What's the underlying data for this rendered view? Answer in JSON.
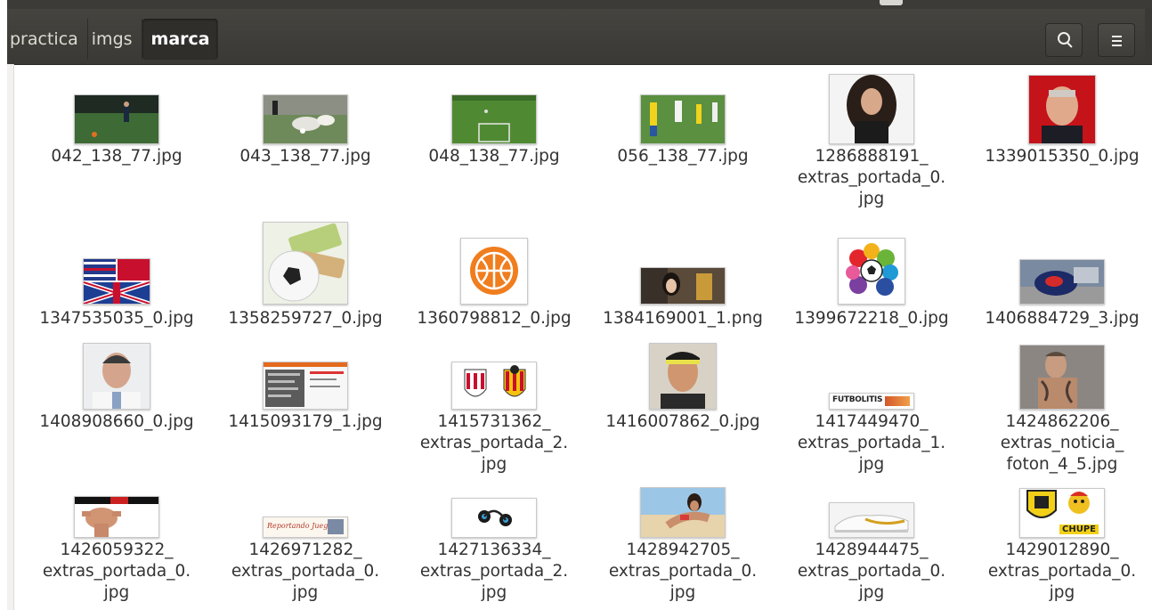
{
  "breadcrumbs": [
    "practica",
    "imgs",
    "marca"
  ],
  "header": {
    "search_icon": "search-icon",
    "menu_icon": "menu-icon"
  },
  "files": [
    {
      "name_lines": [
        "042_138_77.jpg"
      ],
      "icon": "soccer-photo-thumbnail"
    },
    {
      "name_lines": [
        "043_138_77.jpg"
      ],
      "icon": "soccer-photo-thumbnail"
    },
    {
      "name_lines": [
        "048_138_77.jpg"
      ],
      "icon": "soccer-field-thumbnail"
    },
    {
      "name_lines": [
        "056_138_77.jpg"
      ],
      "icon": "soccer-photo-thumbnail"
    },
    {
      "name_lines": [
        "1286888191_",
        "extras_portada_0.",
        "jpg"
      ],
      "icon": "portrait-thumbnail"
    },
    {
      "name_lines": [
        "1339015350_0.jpg"
      ],
      "icon": "portrait-thumbnail"
    },
    {
      "name_lines": [
        "1347535035_0.jpg"
      ],
      "icon": "flags-logo-thumbnail"
    },
    {
      "name_lines": [
        "1358259727_0.jpg"
      ],
      "icon": "money-ball-thumbnail"
    },
    {
      "name_lines": [
        "1360798812_0.jpg"
      ],
      "icon": "basketball-logo-thumbnail"
    },
    {
      "name_lines": [
        "1384169001_1.png"
      ],
      "icon": "photo-thumbnail"
    },
    {
      "name_lines": [
        "1399672218_0.jpg"
      ],
      "icon": "liga-logo-thumbnail"
    },
    {
      "name_lines": [
        "1406884729_3.jpg"
      ],
      "icon": "photo-thumbnail"
    },
    {
      "name_lines": [
        "1408908660_0.jpg"
      ],
      "icon": "portrait-thumbnail"
    },
    {
      "name_lines": [
        "1415093179_1.jpg"
      ],
      "icon": "webpage-thumbnail"
    },
    {
      "name_lines": [
        "1415731362_",
        "extras_portada_2.",
        "jpg"
      ],
      "icon": "club-crests-thumbnail"
    },
    {
      "name_lines": [
        "1416007862_0.jpg"
      ],
      "icon": "portrait-thumbnail"
    },
    {
      "name_lines": [
        "1417449470_",
        "extras_portada_1.",
        "jpg"
      ],
      "icon": "banner-thumbnail",
      "banner_text": "FUTBOLITIS"
    },
    {
      "name_lines": [
        "1424862206_",
        "extras_noticia_",
        "foton_4_5.jpg"
      ],
      "icon": "portrait-thumbnail"
    },
    {
      "name_lines": [
        "1426059322_",
        "extras_portada_0.",
        "jpg"
      ],
      "icon": "banner-thumbnail"
    },
    {
      "name_lines": [
        "1426971282_",
        "extras_portada_0.",
        "jpg"
      ],
      "icon": "banner-thumbnail",
      "banner_text": "Reportando Juego"
    },
    {
      "name_lines": [
        "1427136334_",
        "extras_portada_2.",
        "jpg"
      ],
      "icon": "earphones-thumbnail"
    },
    {
      "name_lines": [
        "1428942705_",
        "extras_portada_0.",
        "jpg"
      ],
      "icon": "beach-photo-thumbnail"
    },
    {
      "name_lines": [
        "1428944475_",
        "extras_portada_0.",
        "jpg"
      ],
      "icon": "boot-thumbnail"
    },
    {
      "name_lines": [
        "1429012890_",
        "extras_portada_0.",
        "jpg"
      ],
      "icon": "crest-mascot-thumbnail",
      "banner_text": "CHUPE"
    }
  ]
}
